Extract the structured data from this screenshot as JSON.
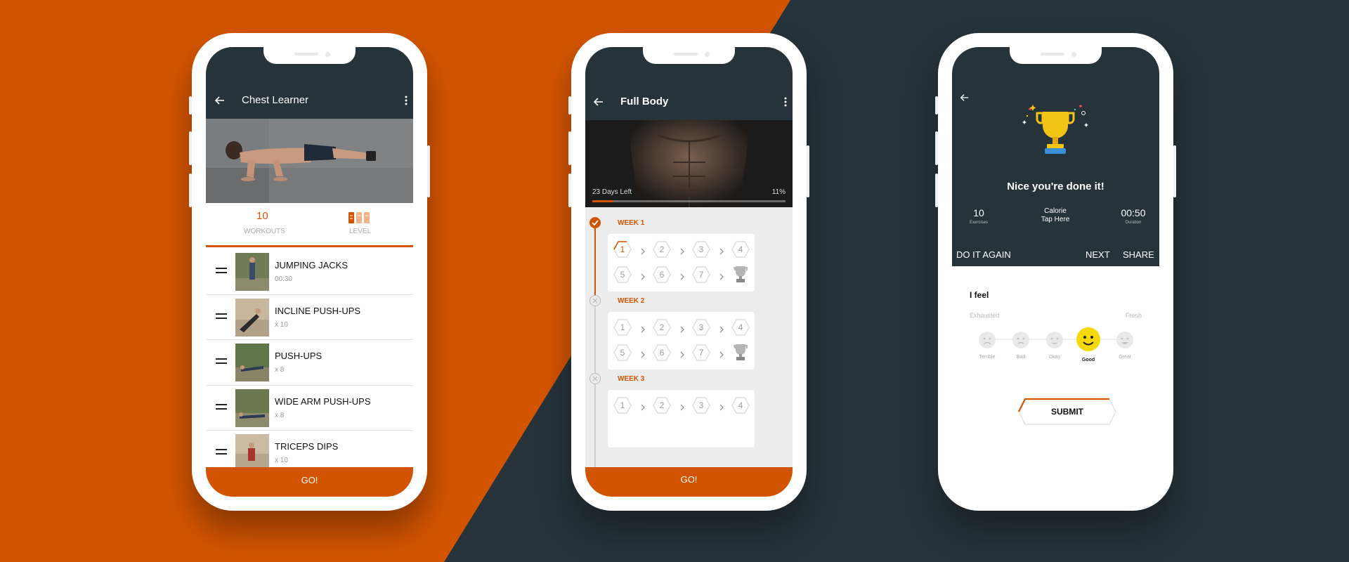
{
  "colors": {
    "accent": "#d35400",
    "dark": "#26333b",
    "light_bg": "#ececec",
    "smile_yellow": "#f5d90a"
  },
  "screen1": {
    "title": "Chest Learner",
    "stats": {
      "workouts_value": "10",
      "workouts_label": "WORKOUTS",
      "level_label": "LEVEL"
    },
    "exercises": [
      {
        "name": "JUMPING JACKS",
        "detail": "00:30"
      },
      {
        "name": "INCLINE PUSH-UPS",
        "detail": "x 10"
      },
      {
        "name": "PUSH-UPS",
        "detail": "x 8"
      },
      {
        "name": "WIDE ARM PUSH-UPS",
        "detail": "x 8"
      },
      {
        "name": "TRICEPS DIPS",
        "detail": "x 10"
      }
    ],
    "go_label": "GO!"
  },
  "screen2": {
    "title": "Full Body",
    "days_left": "23 Days Left",
    "progress_percent": "11%",
    "progress": 0.11,
    "weeks": [
      {
        "label": "WEEK 1",
        "days": [
          "1",
          "2",
          "3",
          "4",
          "5",
          "6",
          "7"
        ]
      },
      {
        "label": "WEEK 2",
        "days": [
          "1",
          "2",
          "3",
          "4",
          "5",
          "6",
          "7"
        ]
      },
      {
        "label": "WEEK 3",
        "days": [
          "1",
          "2",
          "3",
          "4"
        ]
      }
    ],
    "go_label": "GO!"
  },
  "screen3": {
    "message": "Nice you're done it!",
    "stats": [
      {
        "value": "10",
        "label": "Exercises"
      },
      {
        "value": "Calorie",
        "label": "Tap Here"
      },
      {
        "value": "00:50",
        "label": "Duration"
      }
    ],
    "actions": {
      "again": "DO IT AGAIN",
      "next": "NEXT",
      "share": "SHARE"
    },
    "feel_title": "I feel",
    "scale_low": "Exhausted",
    "scale_high": "Fresh",
    "moods": [
      "Terrible",
      "Bad",
      "Okay",
      "Good",
      "Great"
    ],
    "selected_mood": "Good",
    "submit_label": "SUBMIT"
  }
}
